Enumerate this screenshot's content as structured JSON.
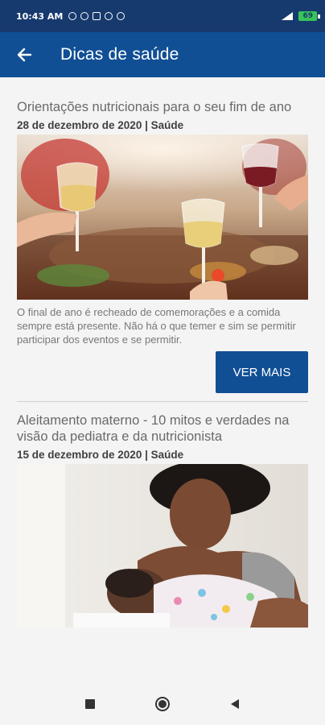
{
  "status_bar": {
    "time": "10:43 AM",
    "battery": "69"
  },
  "app_bar": {
    "title": "Dicas de saúde"
  },
  "articles": [
    {
      "title": "Orientações nutricionais para o seu fim de ano",
      "meta": "28 de dezembro de 2020 | Saúde",
      "image": "celebration-dinner-toast-photo",
      "description": "O final de ano é recheado de comemorações e a comida sempre está presente. Não há o que temer e sim se permitir participar dos eventos e se permitir.",
      "button_label": "VER MAIS"
    },
    {
      "title": "Aleitamento materno - 10 mitos e verdades na visão da pediatra e da nutricionista",
      "meta": "15 de dezembro de 2020 | Saúde",
      "image": "mother-breastfeeding-baby-photo"
    }
  ],
  "colors": {
    "status_bar": "#173a6e",
    "app_bar": "#114f95",
    "button": "#114f95",
    "background": "#f4f4f4"
  },
  "nav_icons": [
    "recents-square-icon",
    "home-circle-icon",
    "back-triangle-icon"
  ]
}
